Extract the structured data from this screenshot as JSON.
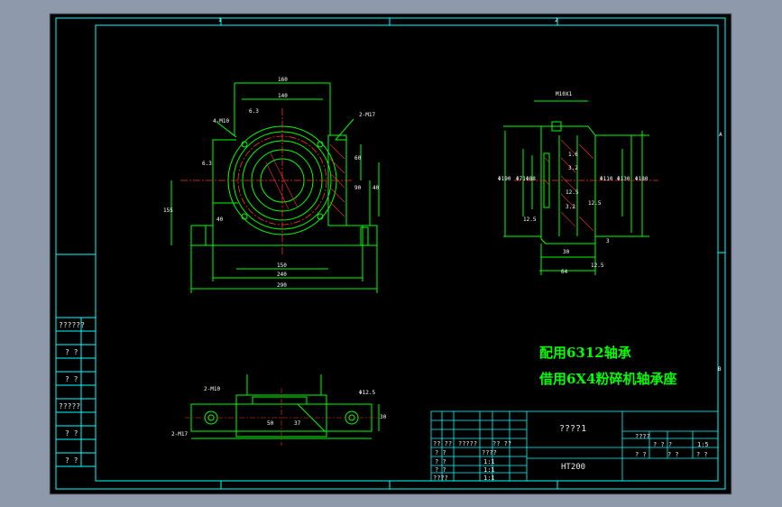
{
  "drawing": {
    "notes": [
      "配用6312轴承",
      "借用6X4粉碎机轴承座"
    ],
    "title_block": {
      "drawing_name": "????1",
      "material": "HT200",
      "scale": "1:5",
      "left_rows": [
        "? ?",
        "????",
        "? ?",
        "? ?",
        "????"
      ],
      "left_row_values": [
        "",
        "????",
        "1:1",
        "1:1",
        "1:1"
      ],
      "header_row": [
        "?? ??",
        "?????",
        "?? ??"
      ],
      "right_top": [
        "????",
        "? ? ?",
        "1:5"
      ],
      "right_bottom": [
        "? ?",
        "? ?",
        "? ?"
      ]
    },
    "side_labels": [
      "??????",
      "? ?",
      "? ?",
      "?????",
      "? ?",
      "? ?"
    ],
    "grid_marks_top": [
      "1",
      "2"
    ],
    "grid_marks_right": [
      "A",
      "B"
    ],
    "front_view_dims": {
      "top": [
        "160",
        "140"
      ],
      "bottom": [
        "150",
        "240",
        "290"
      ],
      "callouts": [
        "4-M10",
        "2-M17",
        "6.3",
        "6.3",
        "40"
      ],
      "right": [
        "60",
        "90",
        "40"
      ],
      "left": [
        "155"
      ]
    },
    "side_view_dims": {
      "top": "M10X1",
      "left": [
        "Φ190",
        "Φ71",
        "Φ88",
        "12.5"
      ],
      "right": [
        "Φ110",
        "Φ130",
        "Φ180",
        "1.6",
        "3.2",
        "12.5",
        "12.5",
        "3.2"
      ],
      "bottom": [
        "30",
        "64",
        "12.5",
        "3"
      ]
    },
    "top_view_dims": {
      "callouts": [
        "2-M10",
        "2-M17",
        "Φ12.5",
        "50",
        "30",
        "37"
      ]
    }
  },
  "colors": {
    "frame_bg": "#8e9aab",
    "paper": "#000000",
    "border": "#00ffff",
    "geometry": "#00ff00",
    "centerline": "#ff3030",
    "hatch": "#ff3030",
    "text": "#ffffff",
    "note": "#00ff00"
  }
}
